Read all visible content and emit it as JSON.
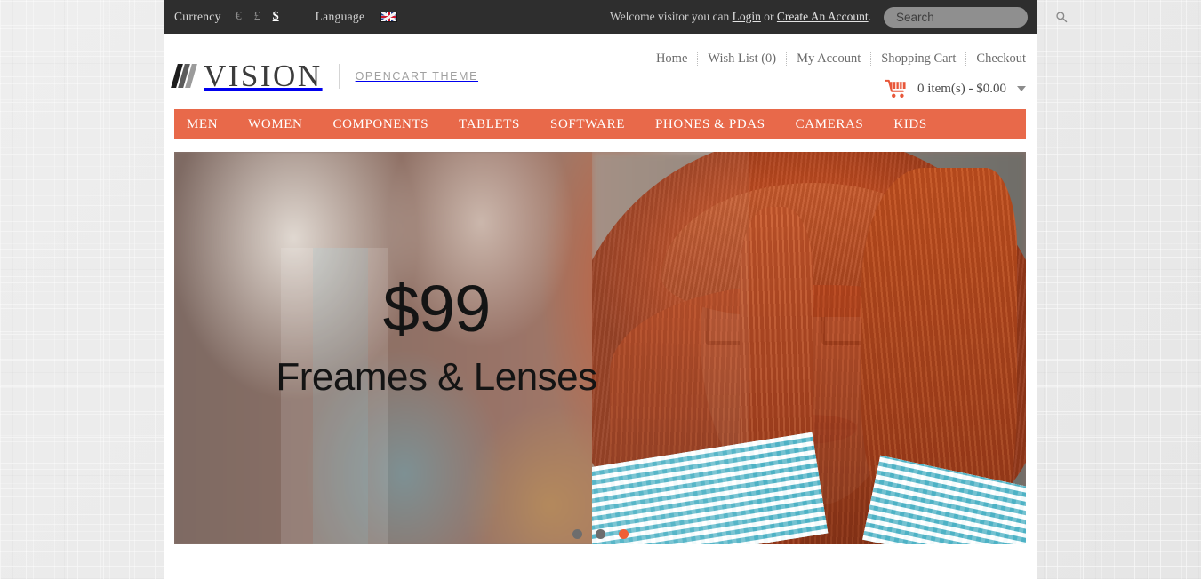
{
  "topbar": {
    "currency_label": "Currency",
    "currencies": [
      {
        "symbol": "€",
        "code": "EUR",
        "active": false
      },
      {
        "symbol": "£",
        "code": "GBP",
        "active": false
      },
      {
        "symbol": "$",
        "code": "USD",
        "active": true
      }
    ],
    "language_label": "Language",
    "language_flag": "uk-flag-icon",
    "welcome_prefix": "Welcome visitor you can ",
    "login_label": "Login",
    "welcome_or": " or ",
    "create_account_label": "Create An Account",
    "welcome_suffix": ".",
    "search_placeholder": "Search",
    "search_value": "",
    "search_icon": "magnifier-icon"
  },
  "header": {
    "logo_mark": "three-slashes-icon",
    "brand": "VISION",
    "tagline": "OPENCART THEME",
    "links": [
      {
        "label": "Home"
      },
      {
        "label": "Wish List (0)"
      },
      {
        "label": "My Account"
      },
      {
        "label": "Shopping Cart"
      },
      {
        "label": "Checkout"
      }
    ],
    "cart": {
      "icon": "shopping-cart-icon",
      "text": "0 item(s) - $0.00",
      "caret": "chevron-down-icon"
    }
  },
  "nav": {
    "items": [
      {
        "label": "MEN"
      },
      {
        "label": "WOMEN"
      },
      {
        "label": "COMPONENTS"
      },
      {
        "label": "TABLETS"
      },
      {
        "label": "SOFTWARE"
      },
      {
        "label": "PHONES & PDAS"
      },
      {
        "label": "CAMERAS"
      },
      {
        "label": "KIDS"
      }
    ]
  },
  "slider": {
    "slide": {
      "price": "$99",
      "subtitle": "Freames & Lenses",
      "image_alt": "woman-with-red-hair-wearing-glasses"
    },
    "dots": [
      {
        "active": false
      },
      {
        "active": false
      },
      {
        "active": true
      }
    ]
  },
  "colors": {
    "accent": "#e8694a",
    "topbar_bg": "#2e2e2e",
    "dot_active": "#ef5f35",
    "dot_inactive": "#6d6d6d",
    "page_bg": "#ffffff"
  }
}
